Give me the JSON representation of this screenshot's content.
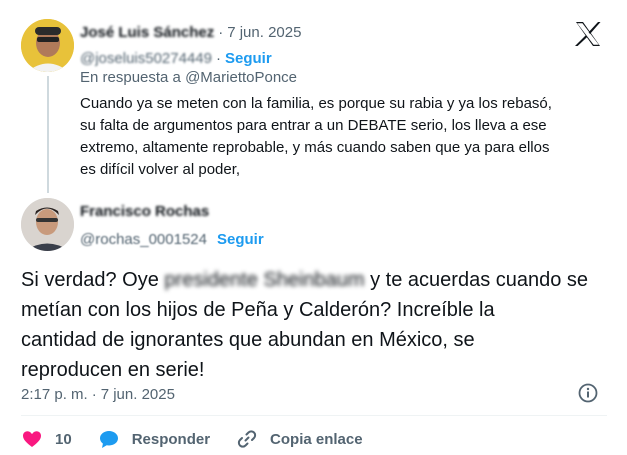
{
  "parent": {
    "name": "José Luis Sánchez",
    "date": "7 jun. 2025",
    "handle": "@joseluis50274449",
    "follow_label": "Seguir",
    "reply_prefix": "En respuesta a ",
    "reply_mention": "@MariettoPonce",
    "text_lines": [
      "Cuando ya se meten con la familia, es porque su rabia y ya los rebasó,",
      "su falta de argumentos para entrar a un DEBATE serio, los lleva a ese",
      "extremo, altamente reprobable, y más cuando saben que ya para ellos",
      "es difícil volver al poder,"
    ]
  },
  "reply": {
    "name": "Francisco Rochas",
    "handle": "@rochas_0001524",
    "follow_label": "Seguir",
    "text_line1_start": "Si verdad? Oye ",
    "text_line1_redacted": "presidente Sheinbaum",
    "text_line1_end": " y te acuerdas cuando se",
    "text_lines_rest": [
      "metían con los hijos de Peña y Calderón? Increíble la",
      "cantidad de ignorantes que abundan en México, se",
      "reproducen en serie!"
    ],
    "time": "2:17 p. m.",
    "date": "7 jun. 2025"
  },
  "actions": {
    "like_count": "10",
    "reply_label": "Responder",
    "copy_link_label": "Copia enlace"
  },
  "colors": {
    "text": "#0f1419",
    "muted": "#536471",
    "accent": "#1d9bf0",
    "like": "#f91880"
  },
  "icons": [
    "x-logo-icon",
    "info-icon",
    "heart-icon",
    "reply-bubble-icon",
    "link-icon"
  ]
}
